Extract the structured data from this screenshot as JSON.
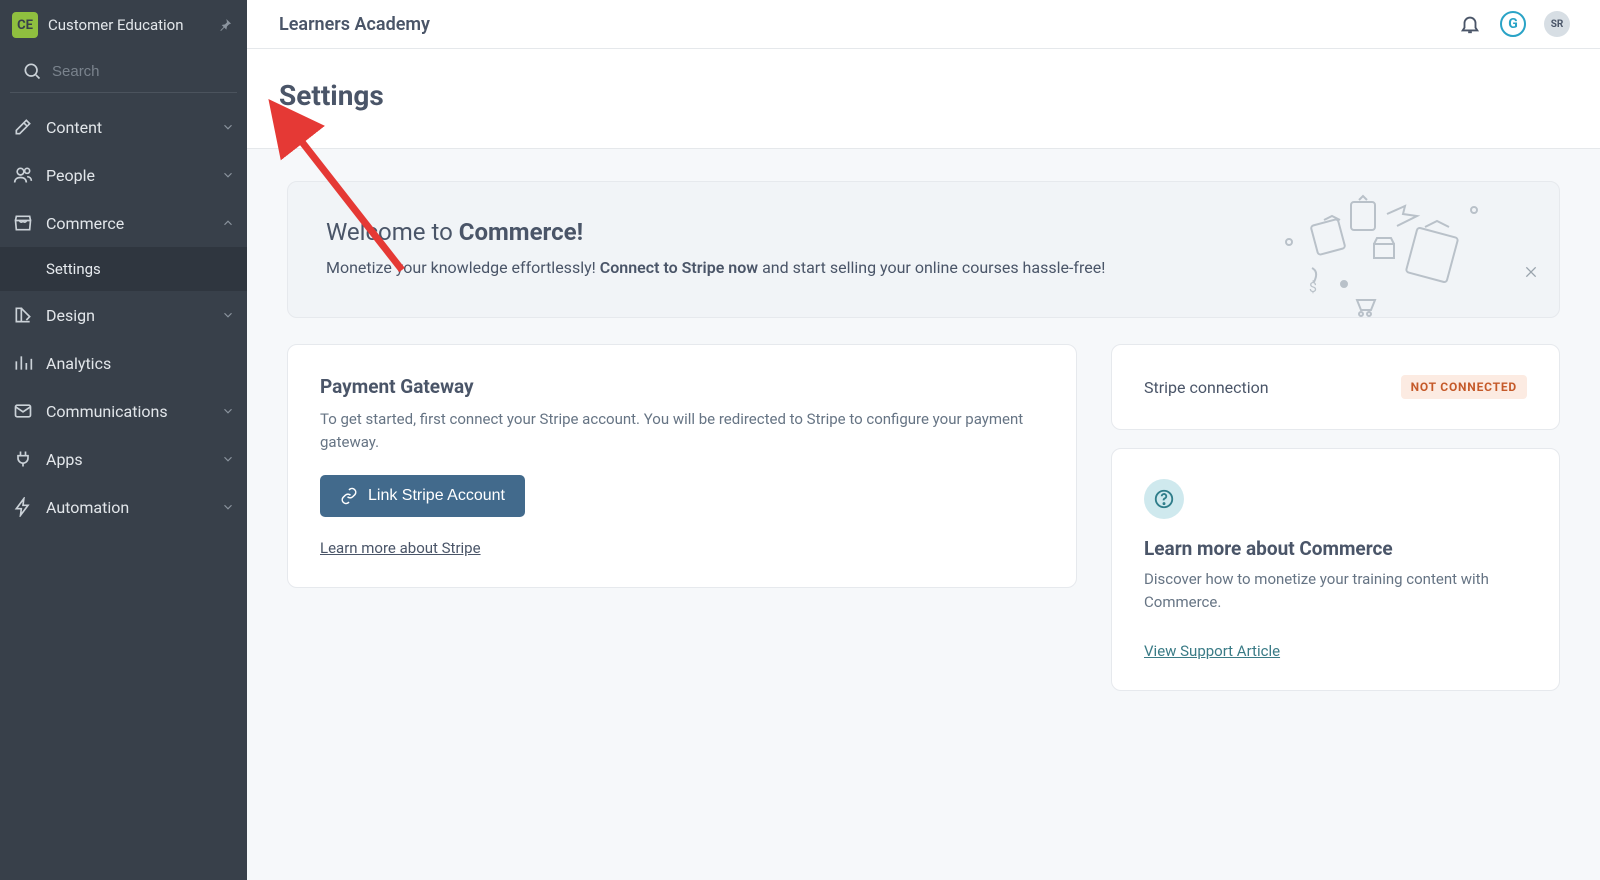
{
  "org": {
    "badge": "CE",
    "name": "Customer Education"
  },
  "search": {
    "placeholder": "Search"
  },
  "sidebar": {
    "items": [
      {
        "label": "Content",
        "icon": "pencil",
        "open": false
      },
      {
        "label": "People",
        "icon": "people",
        "open": false
      },
      {
        "label": "Commerce",
        "icon": "store",
        "open": true,
        "sub": [
          {
            "label": "Settings",
            "active": true
          }
        ]
      },
      {
        "label": "Design",
        "icon": "swatch",
        "open": false
      },
      {
        "label": "Analytics",
        "icon": "chart",
        "open": false
      },
      {
        "label": "Communications",
        "icon": "mail",
        "open": false
      },
      {
        "label": "Apps",
        "icon": "plug",
        "open": false
      },
      {
        "label": "Automation",
        "icon": "bolt",
        "open": false
      }
    ]
  },
  "header": {
    "app_title": "Learners Academy",
    "g_badge": "G",
    "avatar": "SR"
  },
  "page": {
    "title": "Settings",
    "banner": {
      "title_a": "Welcome to",
      "title_b": "Commerce!",
      "desc_pre": "Monetize your knowledge effortlessly! ",
      "desc_bold": "Connect to Stripe now",
      "desc_post": " and start selling your online courses hassle-free!"
    },
    "gateway": {
      "title": "Payment Gateway",
      "desc": "To get started, first connect your Stripe account. You will be redirected to Stripe to configure your payment gateway.",
      "button": "Link Stripe Account",
      "link": "Learn more about Stripe"
    },
    "connection": {
      "label": "Stripe connection",
      "status": "NOT CONNECTED"
    },
    "learn": {
      "title": "Learn more about Commerce",
      "desc": "Discover how to monetize your training content with Commerce.",
      "link": "View Support Article"
    }
  }
}
